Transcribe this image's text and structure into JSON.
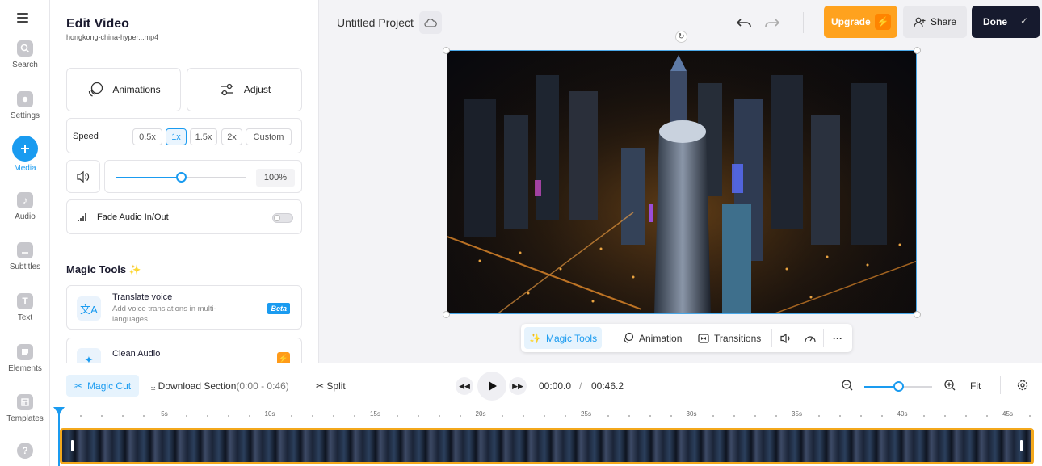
{
  "sidebar": {
    "items": [
      {
        "label": "Search",
        "icon": "search-icon"
      },
      {
        "label": "Settings",
        "icon": "gear-icon"
      },
      {
        "label": "Media",
        "icon": "plus-icon",
        "active": true
      },
      {
        "label": "Audio",
        "icon": "music-note-icon"
      },
      {
        "label": "Subtitles",
        "icon": "subtitles-icon"
      },
      {
        "label": "Text",
        "icon": "text-icon"
      },
      {
        "label": "Elements",
        "icon": "elements-icon"
      },
      {
        "label": "Templates",
        "icon": "templates-icon"
      }
    ],
    "help_icon": "?"
  },
  "panel": {
    "title": "Edit Video",
    "filename": "hongkong-china-hyper...mp4",
    "animations_label": "Animations",
    "adjust_label": "Adjust",
    "speed_label": "Speed",
    "speed_options": [
      "0.5x",
      "1x",
      "1.5x",
      "2x",
      "Custom"
    ],
    "speed_selected": "1x",
    "volume_value": "100%",
    "volume_fraction": 0.5,
    "fade_label": "Fade Audio In/Out",
    "fade_on": false,
    "magic_tools_title": "Magic Tools",
    "tools": [
      {
        "title": "Translate voice",
        "desc": "Add voice translations in multi-languages",
        "badge": "Beta"
      },
      {
        "title": "Clean Audio",
        "desc": "",
        "badge": "⚡"
      }
    ]
  },
  "header": {
    "project_name": "Untitled Project",
    "upgrade_label": "Upgrade",
    "share_label": "Share",
    "done_label": "Done"
  },
  "floating_toolbar": {
    "magic_tools": "Magic Tools",
    "animation": "Animation",
    "transitions": "Transitions"
  },
  "timeline": {
    "magic_cut": "Magic Cut",
    "download_section": "Download Section",
    "download_range": "(0:00 - 0:46)",
    "split": "Split",
    "current_time": "00:00.0",
    "separator": "/",
    "total_time": "00:46.2",
    "fit_label": "Fit",
    "zoom_fraction": 0.5,
    "ruler_labels": [
      "5s",
      "10s",
      "15s",
      "20s",
      "25s",
      "30s",
      "35s",
      "40s",
      "45s"
    ]
  },
  "colors": {
    "accent": "#1a9bf0",
    "upgrade": "#ffa21e",
    "done": "#161a2e",
    "clip_border": "#f3a81c"
  }
}
